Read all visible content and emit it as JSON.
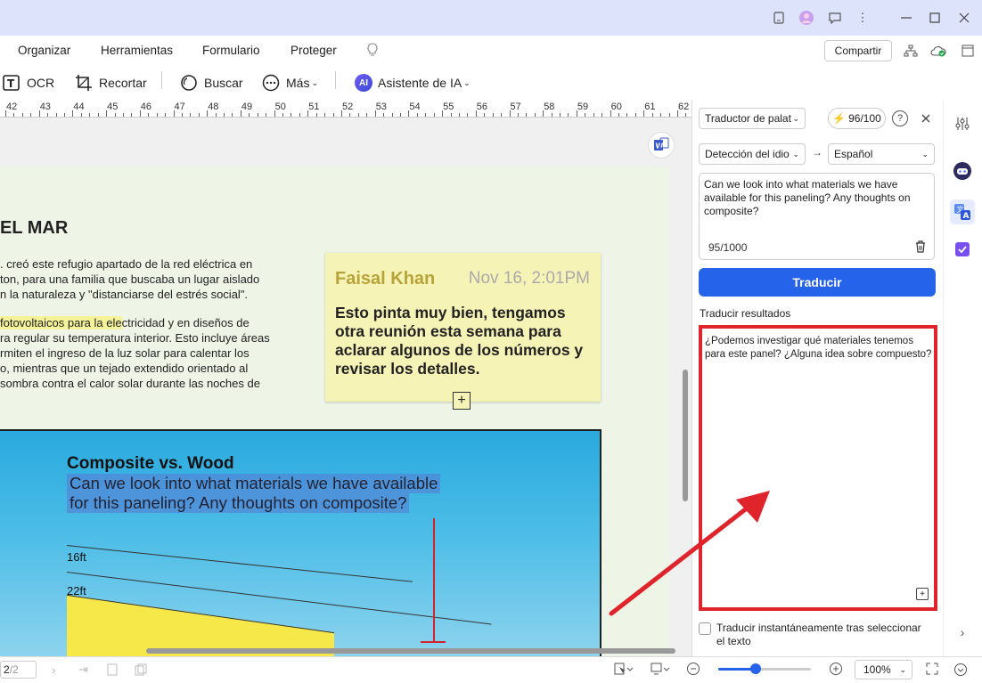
{
  "menu": {
    "items": [
      "Organizar",
      "Herramientas",
      "Formulario",
      "Proteger"
    ],
    "share": "Compartir"
  },
  "toolbar": {
    "ocr": "OCR",
    "crop": "Recortar",
    "search": "Buscar",
    "more": "Más",
    "ai": "Asistente de IA",
    "ai_badge": "AI"
  },
  "ruler": [
    "42",
    "43",
    "44",
    "45",
    "46",
    "47",
    "48",
    "49",
    "50",
    "51",
    "52",
    "53",
    "54",
    "55",
    "56",
    "57",
    "58",
    "59",
    "60",
    "61",
    "62"
  ],
  "document": {
    "heading": "EL MAR",
    "para1": [
      ". creó este refugio apartado de la red eléctrica en",
      "ton, para una familia que buscaba un lugar aislado",
      "n la naturaleza y \"distanciarse del estrés social\"."
    ],
    "para2_highlight": " fotovoltaicos para la ele",
    "para2_first_rest": "ctricidad y en diseños de",
    "para2": [
      "ra regular su temperatura interior. Esto incluye áreas",
      "rmiten el ingreso de la luz solar para calentar los",
      "o, mientras que un tejado extendido orientado al",
      "sombra contra el calor solar durante las noches de"
    ],
    "sticky": {
      "author": "Faisal Khan",
      "date": "Nov 16, 2:01PM",
      "text": "Esto pinta muy bien, tengamos otra reunión esta semana para aclarar algunos de los números y revisar los detalles."
    },
    "photo": {
      "title": "Composite vs. Wood",
      "selected_line1": "Can we look into what materials we have available",
      "selected_line2": "for this paneling? Any thoughts on composite?",
      "label1": "16ft",
      "label2": "22ft"
    }
  },
  "panel": {
    "tool_select": "Traductor de palat",
    "credits": "96/100",
    "source_lang": "Detección del idio",
    "target_lang": "Español",
    "source_text": "Can we look into what materials we have available for this paneling? Any thoughts on composite?",
    "char_count": "95/1000",
    "translate_button": "Traducir",
    "results_label": "Traducir resultados",
    "result_text": "¿Podemos investigar qué materiales tenemos para este panel? ¿Alguna idea sobre compuesto?",
    "instant_label": "Traducir instantáneamente tras seleccionar el texto"
  },
  "status": {
    "page": "2",
    "page_total": "/2",
    "zoom": "100%",
    "zoom_fraction": 0.4
  },
  "colors": {
    "accent": "#2563eb",
    "highlight_box": "#e0242b",
    "titlebar": "#dde3fb"
  }
}
